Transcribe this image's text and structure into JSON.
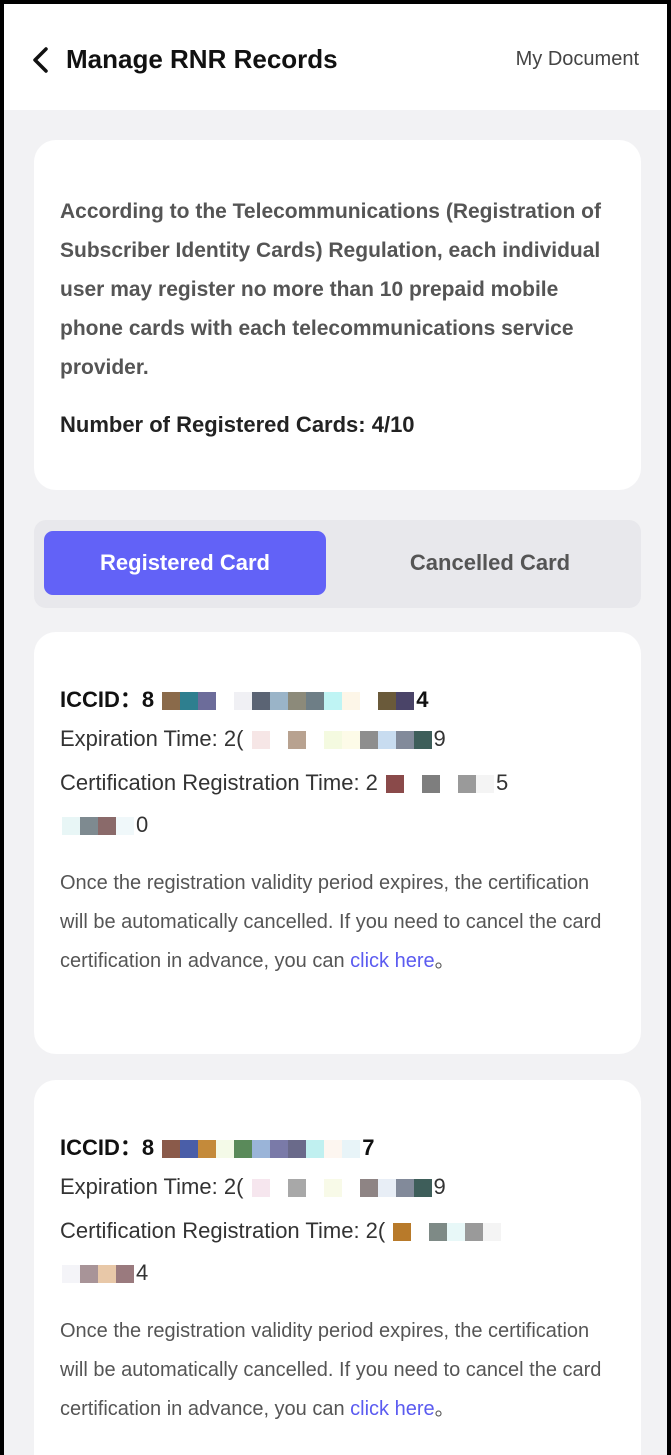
{
  "header": {
    "title": "Manage RNR Records",
    "right_link": "My Document"
  },
  "info": {
    "text": "According to the Telecommunications (Registration of Subscriber Identity Cards) Regulation, each individual user may register no more than 10 prepaid mobile phone cards with each telecommunications service provider.",
    "count_label": "Number of Registered Cards: 4/10"
  },
  "tabs": {
    "registered": "Registered Card",
    "cancelled": "Cancelled Card"
  },
  "records": [
    {
      "iccid_label": "ICCID：",
      "iccid_start": "8",
      "iccid_end": "4",
      "expiration_label": "Expiration Time: ",
      "expiration_start": "2(",
      "expiration_end": "9",
      "cert_label": "Certification Registration Time: ",
      "cert_start": "2",
      "cert_end": "5",
      "cert_line2_end": "0",
      "notice_text": "Once the registration validity period expires, the certification will be automatically cancelled. If you need to cancel the card certification in advance, you can ",
      "link_text": "click here",
      "notice_end": "。"
    },
    {
      "iccid_label": "ICCID：",
      "iccid_start": "8",
      "iccid_end": "7",
      "expiration_label": "Expiration Time: ",
      "expiration_start": "2(",
      "expiration_end": "9",
      "cert_label": "Certification Registration Time: ",
      "cert_start": "2(",
      "cert_end": "",
      "cert_line2_end": "4",
      "notice_text": "Once the registration validity period expires, the certification will be automatically cancelled. If you need to cancel the card certification in advance, you can ",
      "link_text": "click here",
      "notice_end": "。"
    }
  ],
  "colors": {
    "accent": "#6262f7",
    "link": "#5b5bf0",
    "background": "#f2f2f4"
  },
  "icons": {
    "back": "chevron-left-icon"
  }
}
